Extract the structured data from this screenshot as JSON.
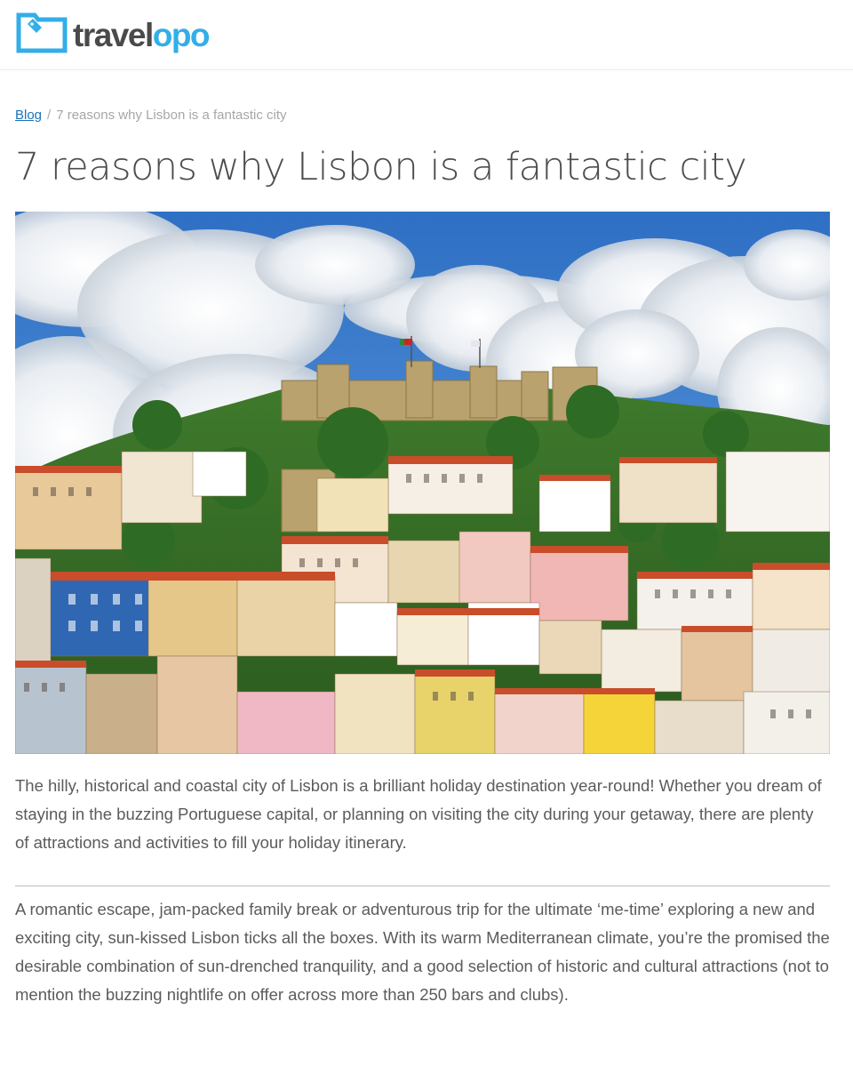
{
  "header": {
    "logo": {
      "text_part1": "travel",
      "text_part2": "opo",
      "icon": "luggage-tag-icon",
      "brand_color": "#32aee8",
      "dark_color": "#4a4a4a"
    }
  },
  "breadcrumb": {
    "home_label": "Blog",
    "separator": "/",
    "current_label": "7 reasons why Lisbon is a fantastic city"
  },
  "article": {
    "title": "7 reasons why Lisbon is a fantastic city",
    "intro": "The hilly, historical and coastal city of Lisbon is a brilliant holiday destination year-round! Whether you dream of staying in the buzzing Portuguese capital, or planning on visiting the city during your getaway, there are plenty of attractions and activities to fill your holiday itinerary.",
    "body_paragraph_1": "A romantic escape, jam-packed family break or adventurous trip for the ultimate ‘me-time’ exploring a new and exciting city, sun-kissed Lisbon ticks all the boxes. With its warm Mediterranean climate, you’re the promised the desirable combination of sun-drenched tranquility, and a good selection of historic and cultural attractions (not to mention the buzzing nightlife on offer across more than 250 bars and clubs)."
  },
  "colors": {
    "link": "#1c72b8",
    "text": "#5b5b5b",
    "title": "#4d4d4d"
  }
}
